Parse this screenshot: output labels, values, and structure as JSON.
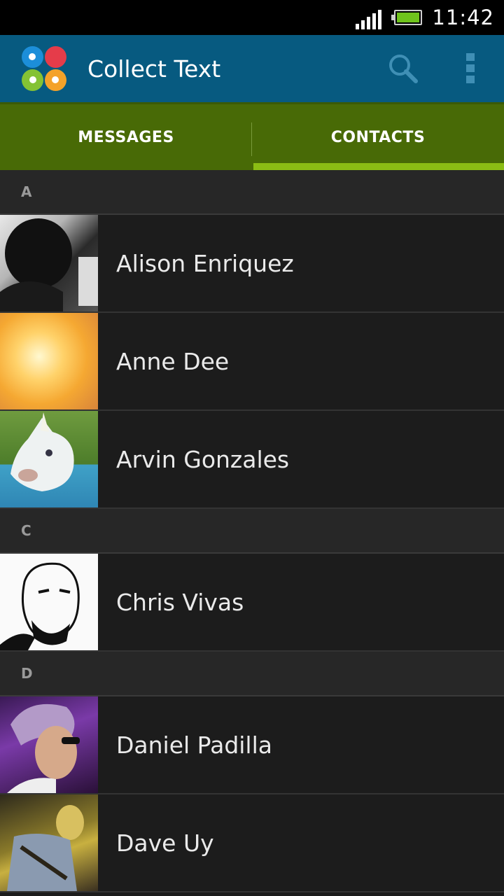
{
  "status_bar": {
    "time": "11:42",
    "signal_icon": "cell-signal-icon",
    "battery_icon": "battery-full-icon",
    "battery_level": 1.0
  },
  "action_bar": {
    "title": "Collect Text",
    "logo_icon": "collect-text-logo-icon",
    "search_icon": "search-icon",
    "overflow_icon": "overflow-menu-icon",
    "background_color": "#075a80"
  },
  "tabs": [
    {
      "label": "MESSAGES",
      "active": false
    },
    {
      "label": "CONTACTS",
      "active": true
    }
  ],
  "colors": {
    "tab_bar": "#486a06",
    "tab_indicator": "#8bbd14",
    "list_background": "#1c1c1c",
    "section_header": "#272727"
  },
  "sections": [
    {
      "letter": "A",
      "contacts": [
        {
          "name": "Alison Enriquez"
        },
        {
          "name": "Anne Dee"
        },
        {
          "name": "Arvin Gonzales"
        }
      ]
    },
    {
      "letter": "C",
      "contacts": [
        {
          "name": "Chris Vivas"
        }
      ]
    },
    {
      "letter": "D",
      "contacts": [
        {
          "name": "Daniel Padilla"
        },
        {
          "name": "Dave Uy"
        }
      ]
    }
  ]
}
